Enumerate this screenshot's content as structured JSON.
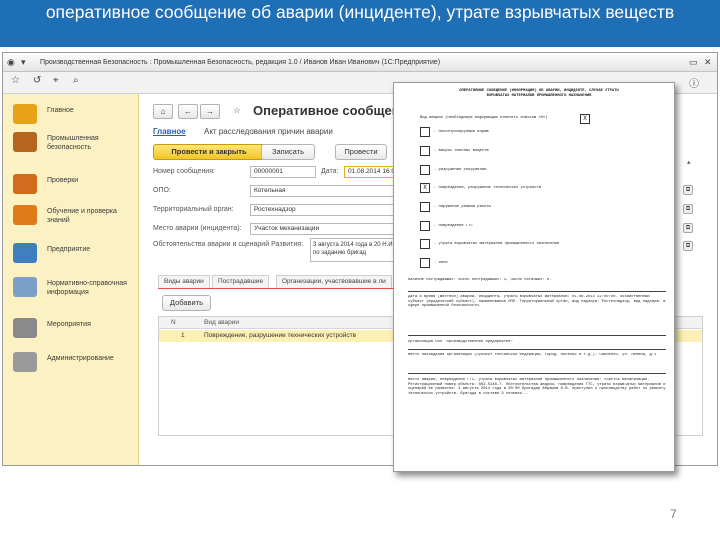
{
  "banner": "оперативное сообщение об аварии (инциденте), утрате взрывчатых веществ",
  "app": {
    "title": "Производственная Безопасность : Промышленная Безопасность, редакция 1.0 / Иванов Иван Иванович  (1С:Предприятие)"
  },
  "sidebar": {
    "items": [
      {
        "label": "Главное",
        "icon": "home-icon",
        "color": "#e8a21a"
      },
      {
        "label": "Промышленная безопасность",
        "icon": "factory-icon",
        "color": "#b5651d"
      },
      {
        "label": "Проверки",
        "icon": "clipboard-icon",
        "color": "#d46a1c"
      },
      {
        "label": "Обучение и проверка знаний",
        "icon": "books-icon",
        "color": "#e07b1a"
      },
      {
        "label": "Предприятие",
        "icon": "building-icon",
        "color": "#3d7fbf"
      },
      {
        "label": "Нормативно-справочная информация",
        "icon": "reference-icon",
        "color": "#7aa0c8"
      },
      {
        "label": "Мероприятия",
        "icon": "gears-icon",
        "color": "#8a8a8a"
      },
      {
        "label": "Администрирование",
        "icon": "admin-icon",
        "color": "#9a9a9a"
      }
    ]
  },
  "form": {
    "title": "Оперативное сообщение о",
    "tabs": {
      "main": "Главное",
      "act": "Акт расследования причин аварии"
    },
    "buttons": {
      "post_close": "Провести и закрыть",
      "save": "Записать",
      "post": "Провести"
    },
    "fields": {
      "number_label": "Номер сообщения:",
      "number_value": "00000001",
      "date_label": "Дата:",
      "date_value": "01.08.2014 16:0",
      "opo_label": "ОПО:",
      "opo_value": "Котельная",
      "org_label": "Территориальный орган:",
      "org_value": "Ростехнадзор",
      "place_label": "Место аварии (инцидента):",
      "place_value": "Участок механизации",
      "reason_label": "Обстоятельства аварии и сценарий Развития:",
      "reason_value": "3 августа 2014 года в 20 Н.И. по заданию бригад"
    },
    "subtabs": [
      "Виды аварии",
      "Пострадавшие",
      "Организации, участвовавшие в ли"
    ],
    "add_label": "Добавить",
    "table": {
      "headers": [
        "N",
        "Вид аварии"
      ],
      "rows": [
        {
          "n": "1",
          "type": "Повреждение, разрушение технических устройств"
        }
      ]
    }
  },
  "document": {
    "title": "ОПЕРАТИВНОЕ СООБЩЕНИЕ (ИНФОРМАЦИЯ) ОБ АВАРИИ, ИНЦИДЕНТЕ, СЛУЧАЕ УТРАТЫ ВЗРЫВЧАТЫХ МАТЕРИАЛОВ ПРОМЫШЛЕННОГО НАЗНАЧЕНИЯ",
    "intro": "Вид аварии (необходимую информацию отметить значком «Х»)",
    "checks": [
      {
        "mark": "",
        "text": "- неконтролируемый взрыв"
      },
      {
        "mark": "",
        "text": "- выброс опасных веществ"
      },
      {
        "mark": "",
        "text": "- разрушение сооружений"
      },
      {
        "mark": "Х",
        "text": "- повреждение, разрушение технических устройств"
      },
      {
        "mark": "",
        "text": "- нарушение режима работы"
      },
      {
        "mark": "",
        "text": "- повреждение ГТС"
      },
      {
        "mark": "",
        "text": "- утрата взрывчатых материалов промышленного назначения"
      },
      {
        "mark": "",
        "text": "- иное"
      }
    ],
    "victims": "Наличие пострадавших: число пострадавших: 1, число погибших: 0.",
    "blocks": [
      "Дата и время (местное) аварии, инцидента, утраты взрывчатых материалов: 01.08.2014 22:00:00. Хозяйственный субъект (юридический субъект), наименование ОПО. Территориальный орган, вид надзора: Ростехнадзор, вид надзора: в сфере промышленной безопасности.",
      "Организация ООО \"Производственное предприятие\"",
      "Место нахождения организации (субъект Российской Федерации, город, поселок и т.д.): Смоленск, ул. Ленина, д.1",
      "Место аварии, повреждения ГТС, утраты взрывчатых материалов промышленного назначения: Участок механизации. Регистрационный номер объекта: А02-5148-7. Обстоятельства аварии, повреждения ГТС, утраты взрывчатых материалов и сценарий ее развития: 3 августа 2014 года в 20:00 бригадир Абрамов Н.И. приступил к производству работ по ремонту технических устройств. Бригада в составе 3 человек..."
    ]
  },
  "page_number": "7"
}
